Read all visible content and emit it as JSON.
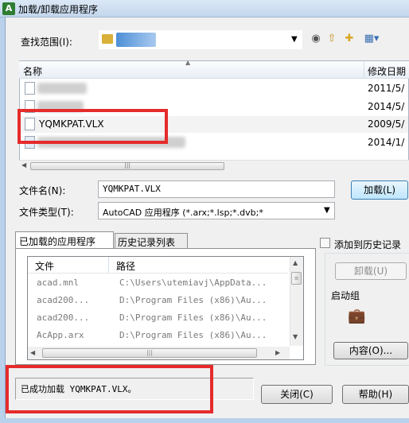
{
  "window": {
    "title": "加载/卸载应用程序",
    "app_icon": "autocad-icon"
  },
  "lookin": {
    "label": "查找范围(I):",
    "value": "",
    "toolbar_icons": [
      "back-icon",
      "up-folder-icon",
      "new-folder-icon",
      "views-menu-icon"
    ]
  },
  "filelist": {
    "col_name": "名称",
    "col_date": "修改日期",
    "rows": [
      {
        "name": "",
        "date": "2011/5/"
      },
      {
        "name": "",
        "date": "2014/5/"
      },
      {
        "name": "YQMKPAT.VLX",
        "date": "2009/5/"
      },
      {
        "name": "",
        "date": "2014/1/"
      }
    ]
  },
  "filename": {
    "label": "文件名(N):",
    "value": "YQMKPAT.VLX"
  },
  "filetype": {
    "label": "文件类型(T):",
    "value": "AutoCAD 应用程序 (*.arx;*.lsp;*.dvb;*"
  },
  "buttons": {
    "load": "加载(L)",
    "unload": "卸载(U)",
    "contents": "内容(O)...",
    "close": "关闭(C)",
    "help": "帮助(H)"
  },
  "tabs": {
    "loaded": "已加载的应用程序",
    "history": "历史记录列表"
  },
  "loaded_list": {
    "col_file": "文件",
    "col_path": "路径",
    "rows": [
      {
        "file": "acad.mnl",
        "path": "C:\\Users\\utemiavj\\AppData..."
      },
      {
        "file": "acad200...",
        "path": "D:\\Program Files (x86)\\Au..."
      },
      {
        "file": "acad200...",
        "path": "D:\\Program Files (x86)\\Au..."
      },
      {
        "file": "AcApp.arx",
        "path": "D:\\Program Files (x86)\\Au..."
      }
    ]
  },
  "right_panel": {
    "add_history": "添加到历史记录",
    "add_history_checked": false,
    "startup_group": "启动组",
    "startup_icon": "briefcase-icon"
  },
  "status": {
    "message": "已成功加载 YQMKPAT.VLX。"
  },
  "colors": {
    "highlight": "#e52b2b",
    "titlebar": "#c3d6ec"
  }
}
